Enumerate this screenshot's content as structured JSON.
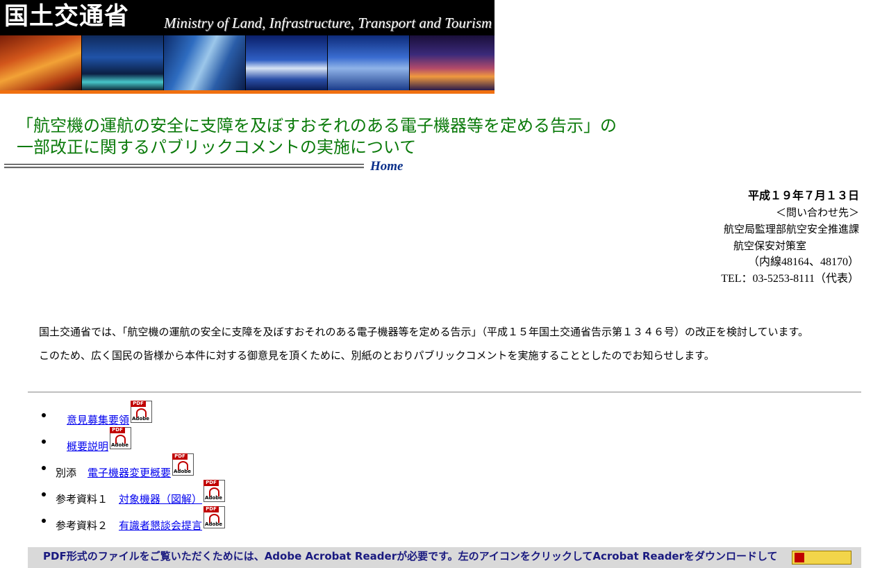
{
  "header": {
    "logo_jp": "国土交通省",
    "logo_en": "Ministry of Land, Infrastructure, Transport and Tourism"
  },
  "title": {
    "line1": "「航空機の運航の安全に支障を及ぼすおそれのある電子機器等を定める告示」の",
    "line2": "一部改正に関するパブリックコメントの実施について",
    "home_link": "Home"
  },
  "info": {
    "date": "平成１９年７月１３日",
    "contact_heading": "＜問い合わせ先＞",
    "dept1": "航空局監理部航空安全推進課",
    "dept2": "航空保安対策室",
    "extension": "（内線48164、48170）",
    "tel": "TEL：03-5253-8111（代表）"
  },
  "body": {
    "paragraph1": "国土交通省では、「航空機の運航の安全に支障を及ぼすおそれのある電子機器等を定める告示」（平成１５年国土交通省告示第１３４６号）の改正を検討しています。",
    "paragraph2": "このため、広く国民の皆様から本件に対する御意見を頂くために、別紙のとおりパブリックコメントを実施することとしたのでお知らせします。"
  },
  "documents": [
    {
      "prefix": "",
      "link": "意見募集要領"
    },
    {
      "prefix": "",
      "link": "概要説明"
    },
    {
      "prefix": "別添",
      "link": "電子機器変更概要"
    },
    {
      "prefix": "参考資料１",
      "link": "対象機器（図解）"
    },
    {
      "prefix": "参考資料２",
      "link": "有識者懇談会提言"
    }
  ],
  "pdf_icon": {
    "tag": "PDF",
    "brand": "Adobe"
  },
  "footer_note": {
    "text": "PDF形式のファイルをご覧いただくためには、Adobe Acrobat Readerが必要です。左のアイコンをクリックしてAcrobat Readerをダウンロードして"
  },
  "colors": {
    "title_green": "#0a7a0a",
    "home_blue": "#0a2f8a",
    "link_blue": "#0000ee",
    "banner_orange": "#f07010"
  }
}
